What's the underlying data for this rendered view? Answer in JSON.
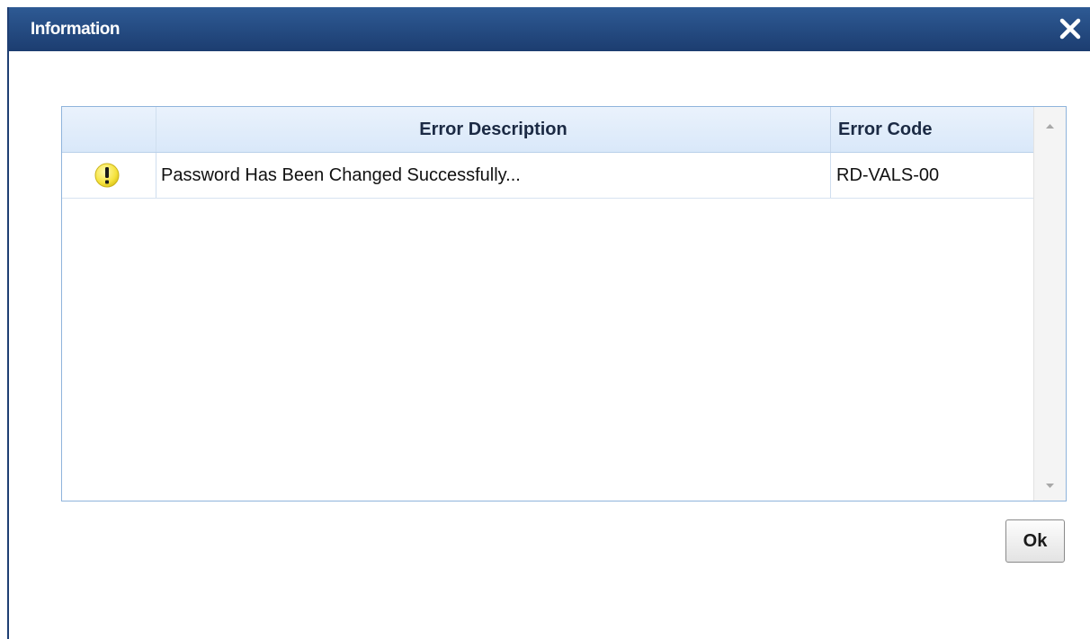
{
  "dialog": {
    "title": "Information"
  },
  "table": {
    "columns": {
      "description": "Error Description",
      "code": "Error Code"
    },
    "rows": [
      {
        "icon": "warning-icon",
        "description": "Password Has Been Changed Successfully...",
        "code": "RD-VALS-00"
      }
    ]
  },
  "buttons": {
    "ok_label": "Ok"
  },
  "colors": {
    "titlebar": "#1f4278",
    "header_bg": "#e1ecfa",
    "grid_border": "#8fb4dc",
    "warning_fill": "#f7e84a"
  }
}
